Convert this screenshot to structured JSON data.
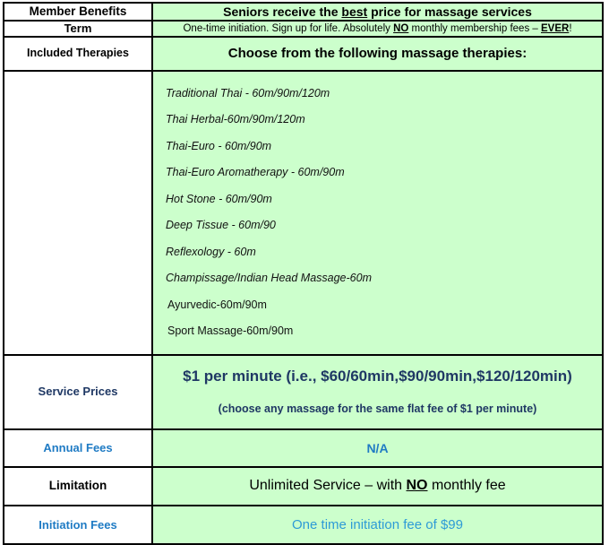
{
  "table": {
    "rows": [
      {
        "key": "member_benefits",
        "label": "Member Benefits",
        "value_pre": "Seniors receive the ",
        "value_emph": "best",
        "value_post": " price for massage services"
      },
      {
        "key": "term",
        "label": "Term",
        "value_a": "One-time initiation.  Sign up for life.  Absolutely ",
        "value_emph1": "NO",
        "value_b": " monthly membership fees – ",
        "value_emph2": "EVER",
        "value_c": "!"
      },
      {
        "key": "included_therapies",
        "label": "Included Therapies",
        "value": "Choose from the following massage therapies:"
      },
      {
        "key": "therapy_list",
        "label": "",
        "items": [
          "Traditional Thai - 60m/90m/120m",
          "Thai Herbal-60m/90m/120m",
          "Thai-Euro - 60m/90m",
          "Thai-Euro Aromatherapy - 60m/90m",
          "Hot Stone - 60m/90m",
          "Deep Tissue - 60m/90",
          "Reflexology - 60m",
          "Champissage/Indian Head Massage-60m",
          "Ayurvedic-60m/90m",
          "Sport Massage-60m/90m"
        ]
      },
      {
        "key": "service_prices",
        "label": "Service Prices",
        "value_main": "$1 per minute  (i.e., $60/60min,$90/90min,$120/120min)",
        "value_sub": "(choose any massage for the same flat fee of $1 per minute)"
      },
      {
        "key": "annual_fees",
        "label": "Annual Fees",
        "value": "N/A"
      },
      {
        "key": "limitation",
        "label": "Limitation",
        "value_a": "Unlimited Service – with ",
        "value_emph": "NO",
        "value_b": " monthly fee"
      },
      {
        "key": "initiation_fees",
        "label": "Initiation Fees",
        "value": "One time initiation fee of $99"
      }
    ]
  },
  "colors": {
    "cell_green": "#CCFFCC",
    "navy": "#1F3864",
    "blue": "#1F7BC4",
    "light_blue": "#2E9BD6",
    "border": "#000000"
  }
}
